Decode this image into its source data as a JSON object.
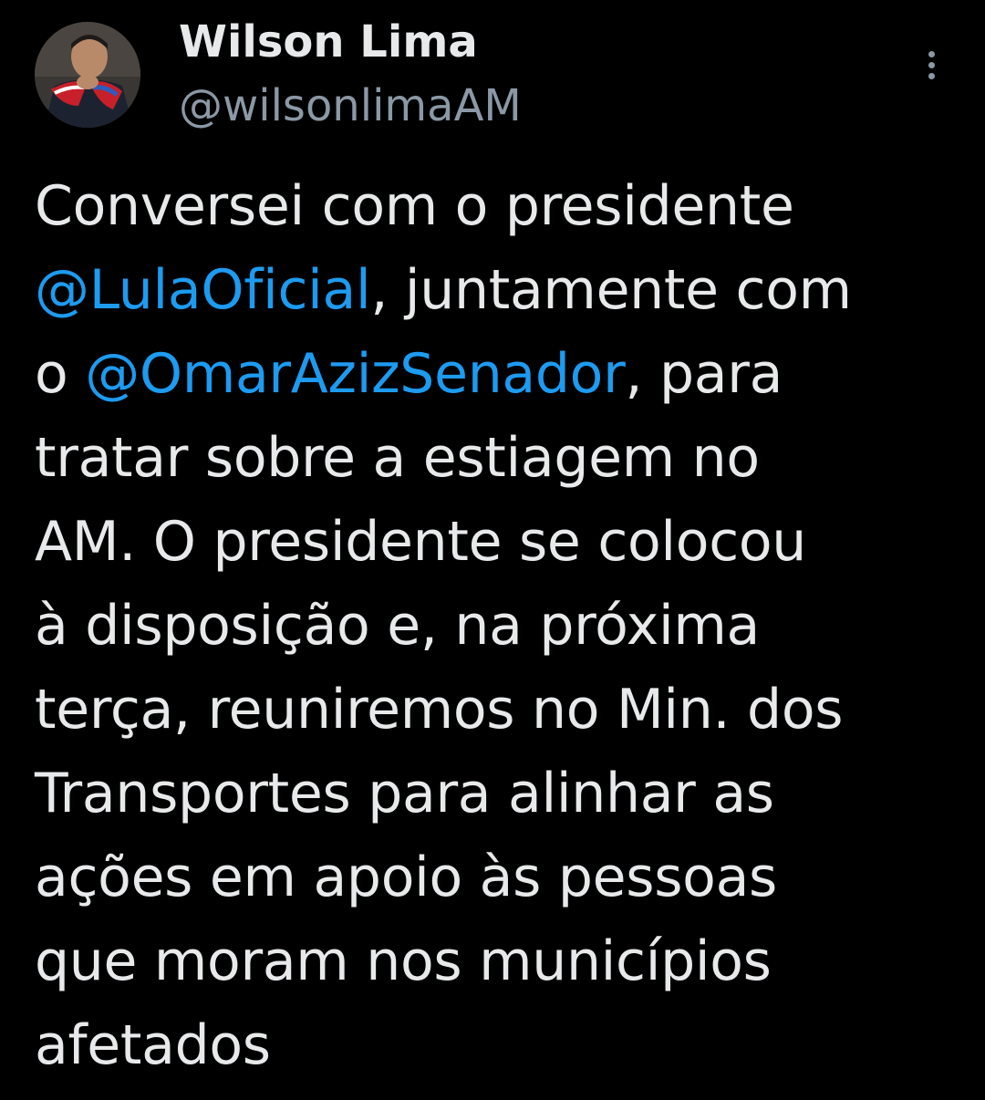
{
  "author": {
    "display_name": "Wilson Lima",
    "handle": "@wilsonlimaAM",
    "avatar_icon": "profile-photo"
  },
  "more_icon": "vertical-ellipsis-icon",
  "colors": {
    "background": "#000000",
    "text": "#e7e9ea",
    "secondary_text": "#8b98a5",
    "mention": "#1d9bf0"
  },
  "tweet": {
    "lines": [
      {
        "parts": [
          {
            "text": "Conversei com o presidente"
          }
        ]
      },
      {
        "parts": [
          {
            "text": "@LulaOficial",
            "mention": true
          },
          {
            "text": ", juntamente com"
          }
        ]
      },
      {
        "parts": [
          {
            "text": "o "
          },
          {
            "text": "@OmarAzizSenador",
            "mention": true
          },
          {
            "text": ", para"
          }
        ]
      },
      {
        "parts": [
          {
            "text": "tratar sobre a estiagem no"
          }
        ]
      },
      {
        "parts": [
          {
            "text": "AM. O presidente se colocou"
          }
        ]
      },
      {
        "parts": [
          {
            "text": "à disposição e, na próxima"
          }
        ]
      },
      {
        "parts": [
          {
            "text": "terça, reuniremos no Min. dos"
          }
        ]
      },
      {
        "parts": [
          {
            "text": "Transportes para alinhar as"
          }
        ]
      },
      {
        "parts": [
          {
            "text": "ações em apoio às pessoas"
          }
        ]
      },
      {
        "parts": [
          {
            "text": "que moram nos municípios"
          }
        ]
      },
      {
        "parts": [
          {
            "text": "afetados"
          }
        ]
      }
    ]
  }
}
